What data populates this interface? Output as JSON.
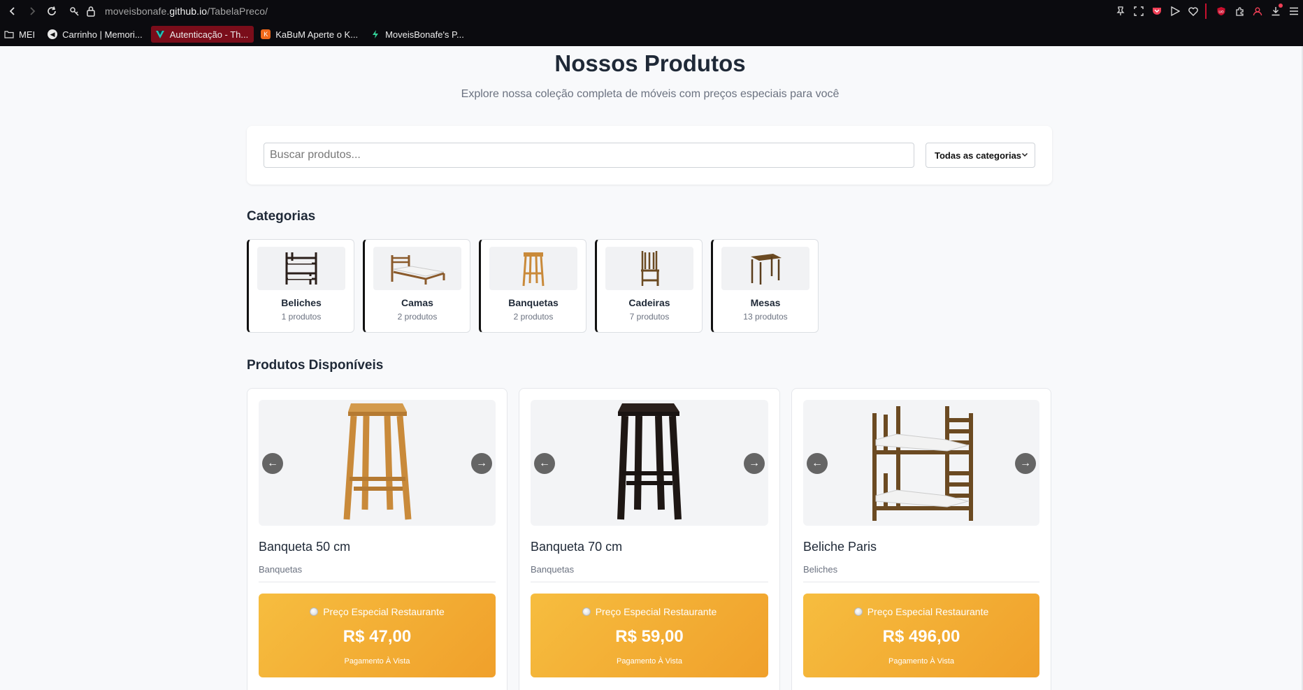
{
  "browser": {
    "url_prefix": "moveisbonafe.",
    "url_domain": "github.io",
    "url_path": "/TabelaPreco/",
    "bookmarks": [
      {
        "label": "MEI"
      },
      {
        "label": "Carrinho | Memori..."
      },
      {
        "label": "Autenticação - Th..."
      },
      {
        "label": "KaBuM Aperte o K..."
      },
      {
        "label": "MoveisBonafe's P..."
      }
    ]
  },
  "header": {
    "title": "Nossos Produtos",
    "subtitle": "Explore nossa coleção completa de móveis com preços especiais para você"
  },
  "search": {
    "placeholder": "Buscar produtos...",
    "category_select": "Todas as categorias"
  },
  "categories": {
    "heading": "Categorias",
    "items": [
      {
        "name": "Beliches",
        "count": "1 produtos",
        "icon": "bunk-bed-icon"
      },
      {
        "name": "Camas",
        "count": "2 produtos",
        "icon": "bed-icon"
      },
      {
        "name": "Banquetas",
        "count": "2 produtos",
        "icon": "stool-icon"
      },
      {
        "name": "Cadeiras",
        "count": "7 produtos",
        "icon": "chair-icon"
      },
      {
        "name": "Mesas",
        "count": "13 produtos",
        "icon": "table-icon"
      }
    ]
  },
  "products": {
    "heading": "Produtos Disponíveis",
    "prev_arrow": "←",
    "next_arrow": "→",
    "items": [
      {
        "name": "Banqueta 50 cm",
        "category": "Banquetas",
        "price_label": "Preço Especial Restaurante",
        "price": "R$ 47,00",
        "payment": "Pagamento À Vista",
        "color": "#c98a3a"
      },
      {
        "name": "Banqueta 70 cm",
        "category": "Banquetas",
        "price_label": "Preço Especial Restaurante",
        "price": "R$ 59,00",
        "payment": "Pagamento À Vista",
        "color": "#1e1714"
      },
      {
        "name": "Beliche Paris",
        "category": "Beliches",
        "price_label": "Preço Especial Restaurante",
        "price": "R$ 496,00",
        "payment": "Pagamento À Vista",
        "color": "#6b4a22"
      }
    ]
  },
  "colors": {
    "price_gradient_start": "#f6bd3f",
    "price_gradient_end": "#f0a02b",
    "accent_border": "#111111"
  }
}
